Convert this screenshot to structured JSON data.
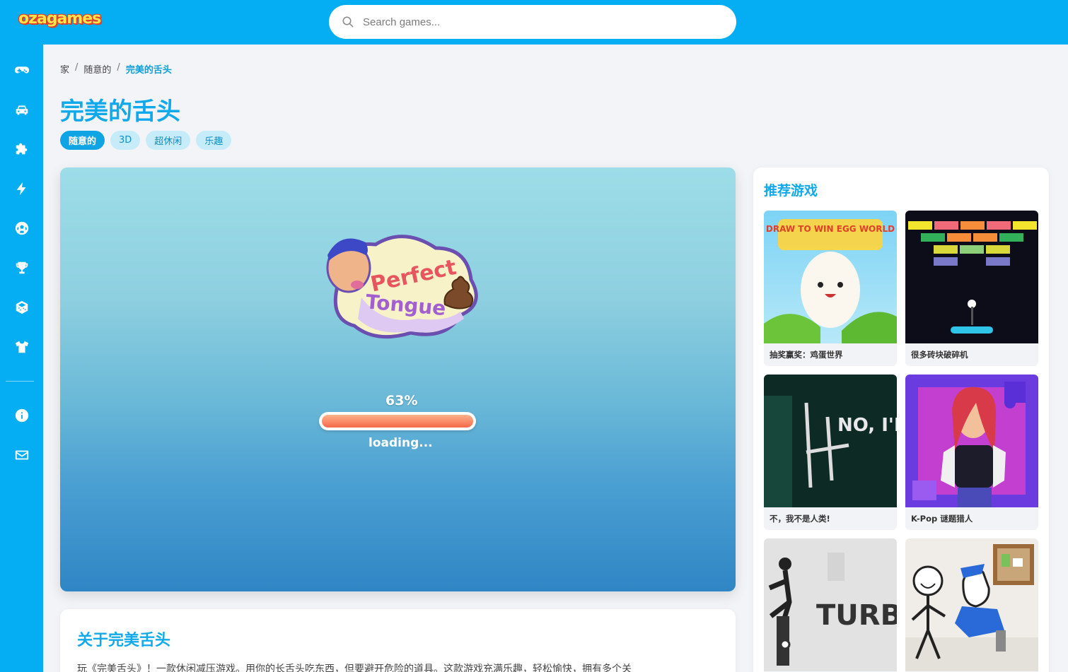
{
  "header": {
    "logo": "ozagames",
    "search_placeholder": "Search games..."
  },
  "sidebar": {
    "items": [
      {
        "icon": "gamepad-icon"
      },
      {
        "icon": "car-icon"
      },
      {
        "icon": "puzzle-icon"
      },
      {
        "icon": "lightning-icon"
      },
      {
        "icon": "soccer-ball-icon"
      },
      {
        "icon": "trophy-icon"
      },
      {
        "icon": "dice-icon"
      },
      {
        "icon": "shirt-icon"
      },
      {
        "icon": "info-icon"
      },
      {
        "icon": "mail-icon"
      }
    ]
  },
  "breadcrumb": {
    "home": "家",
    "category": "随意的",
    "current": "完美的舌头",
    "separator": "/"
  },
  "page": {
    "title": "完美的舌头",
    "tags": [
      "随意的",
      "3D",
      "超休闲",
      "乐趣"
    ]
  },
  "game": {
    "logo_line1": "Perfect",
    "logo_line2": "Tongue",
    "progress_label": "63%",
    "progress": 0.63,
    "loading_text": "loading..."
  },
  "about": {
    "title": "关于完美舌头",
    "text": "玩《完美舌头》！一款休闲减压游戏。用你的长舌头吃东西，但要避开危险的道具。这款游戏充满乐趣，轻松愉快，拥有多个关"
  },
  "recommended": {
    "title": "推荐游戏",
    "games": [
      {
        "name": "抽奖赢奖：鸡蛋世界",
        "thumb_text": "DRAW TO WIN EGG WORLD"
      },
      {
        "name": "很多砖块破碎机",
        "thumb_text": ""
      },
      {
        "name": "不，我不是人类!",
        "thumb_text": "NO, I'M A HUM"
      },
      {
        "name": "K-Pop 谜题猎人",
        "thumb_text": ""
      },
      {
        "name": "",
        "thumb_text": "TURB DISMOUNT"
      },
      {
        "name": "",
        "thumb_text": ""
      }
    ]
  },
  "colors": {
    "brand": "#05aef2",
    "title": "#12a9ea",
    "tag_bg": "#c7ecf9"
  }
}
